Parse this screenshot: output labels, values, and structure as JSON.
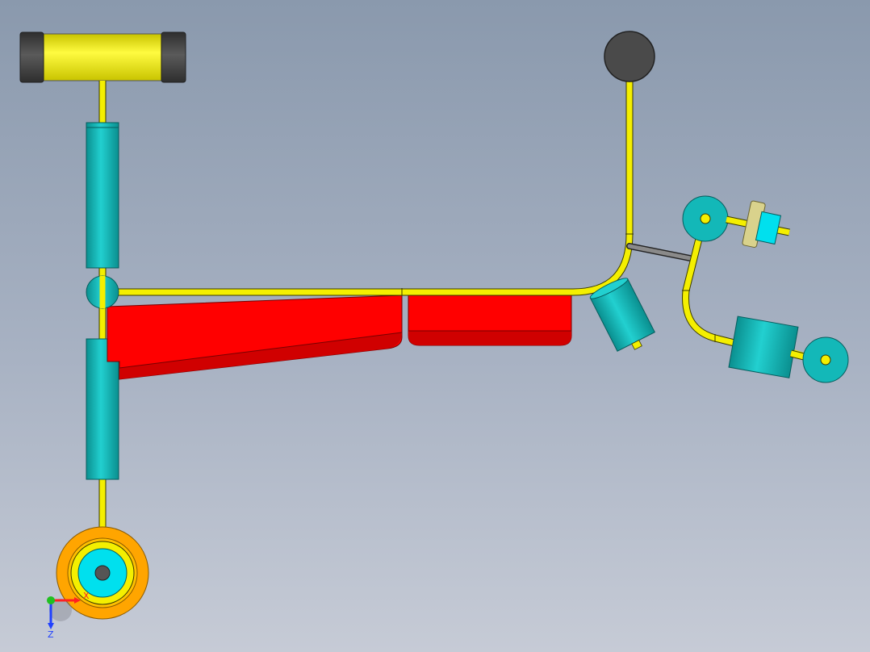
{
  "viewport": {
    "background_top": "#8a99ad",
    "background_bottom": "#c6cbd6"
  },
  "colors": {
    "tube": "#f4ef00",
    "tube_outline": "#3a3a00",
    "cylinder": "#13b8b8",
    "cylinder_light": "#22d0d0",
    "cylinder_dark": "#0a8f8f",
    "panel": "#ff0000",
    "panel_dark": "#b00000",
    "rubber": "#444444",
    "bolt": "#555555",
    "wheel_outer": "#ffa500",
    "wheel_inner": "#00e0ee",
    "washer": "#d9d28c"
  },
  "triad": {
    "x_label": "X",
    "z_label": "Z",
    "x_color": "#ff2020",
    "y_color": "#20c020",
    "z_color": "#2040ff"
  }
}
